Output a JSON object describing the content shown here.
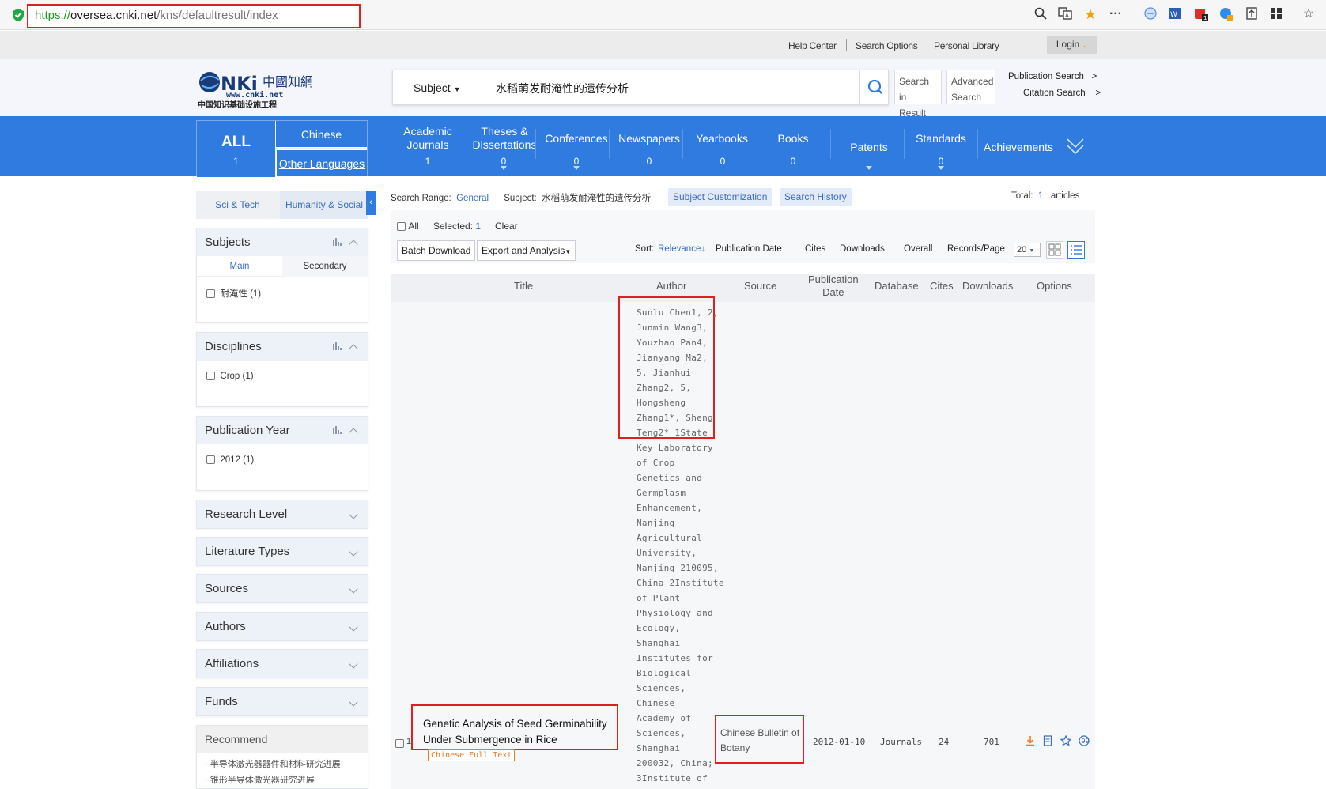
{
  "browser": {
    "url_scheme": "https://",
    "url_host": "oversea.cnki.net",
    "url_path": "/kns/defaultresult/index",
    "icons": [
      "shield-icon",
      "zoom-icon",
      "translate-icon",
      "star-icon",
      "more-icon",
      "extension-icon",
      "word-icon",
      "badge-icon",
      "collection-icon",
      "upload-icon",
      "grid-icon",
      "bookmark-icon"
    ]
  },
  "top_links": {
    "help": "Help Center",
    "options": "Search Options",
    "library": "Personal Library",
    "login": "Login"
  },
  "logo": {
    "main": "CNKi中国知网",
    "url": "www.cnki.net",
    "sub": "中国知识基础设施工程"
  },
  "search": {
    "field": "Subject",
    "query": "水稻萌发耐淹性的遗传分析",
    "search_in_result_1": "Search in",
    "search_in_result_2": "Result",
    "advanced_1": "Advanced",
    "advanced_2": "Search",
    "publication_search": "Publication Search",
    "citation_search": "Citation Search",
    "arrow": ">"
  },
  "nav": {
    "all_label": "ALL",
    "all_count": "1",
    "chinese": "Chinese",
    "other_languages": "Other Languages",
    "items": [
      {
        "l1": "Academic",
        "l2": "Journals",
        "count": "1"
      },
      {
        "l1": "Theses &",
        "l2": "Dissertations",
        "count": "0"
      },
      {
        "l1": "Conferences",
        "l2": "",
        "count": "0"
      },
      {
        "l1": "Newspapers",
        "l2": "",
        "count": "0"
      },
      {
        "l1": "Yearbooks",
        "l2": "",
        "count": "0"
      },
      {
        "l1": "Books",
        "l2": "",
        "count": "0"
      },
      {
        "l1": "Patents",
        "l2": "",
        "count": ""
      },
      {
        "l1": "Standards",
        "l2": "",
        "count": "0"
      },
      {
        "l1": "Achievements",
        "l2": "",
        "count": ""
      }
    ]
  },
  "sidebar": {
    "tab_sci": "Sci & Tech",
    "tab_hum": "Humanity & Social",
    "subjects": "Subjects",
    "main": "Main",
    "secondary": "Secondary",
    "subject_facet": "耐淹性  (1)",
    "disciplines": "Disciplines",
    "discipline_facet": "Crop  (1)",
    "pubyear": "Publication Year",
    "year_facet": "2012  (1)",
    "collapsed": [
      "Research Level",
      "Literature Types",
      "Sources",
      "Authors",
      "Affiliations",
      "Funds"
    ],
    "recommend": "Recommend",
    "rec_items": [
      "半导体激光器器件和材料研究进展",
      "锥形半导体激光器研究进展"
    ]
  },
  "results": {
    "range_label": "Search Range:",
    "range_value": "General",
    "subject_label": "Subject:",
    "subject_value": "水稻萌发耐淹性的遗传分析",
    "subject_custom": "Subject Customization",
    "history": "Search History",
    "total_label": "Total:",
    "total_value": "1",
    "total_unit": "articles",
    "all": "All",
    "selected_label": "Selected:",
    "selected_value": "1",
    "clear": "Clear",
    "batch_download": "Batch Download",
    "export": "Export and Analysis",
    "sort_label": "Sort:",
    "sort_relevance": "Relevance",
    "sort_pubdate": "Publication Date",
    "sort_cites": "Cites",
    "sort_downloads": "Downloads",
    "sort_overall": "Overall",
    "records_label": "Records/Page",
    "records_value": "20",
    "columns": {
      "title": "Title",
      "author": "Author",
      "source": "Source",
      "pubdate_1": "Publication",
      "pubdate_2": "Date",
      "database": "Database",
      "cites": "Cites",
      "downloads": "Downloads",
      "options": "Options"
    },
    "row": {
      "index": "1",
      "title_1": "Genetic Analysis of Seed Germinability",
      "title_2": "Under Submergence in Rice",
      "fulltext_tag": "Chinese Full Text",
      "author_lines": [
        "Sunlu Chen1, 2,",
        "Junmin Wang3,",
        "Youzhao Pan4,",
        "Jianyang Ma2,",
        "5, Jianhui",
        "Zhang2, 5,",
        "Hongsheng",
        "Zhang1*, Sheng",
        "Teng2* 1State",
        "Key Laboratory",
        "of Crop",
        "Genetics and",
        "Germplasm",
        "Enhancement,",
        "Nanjing",
        "Agricultural",
        "University,",
        "Nanjing 210095,",
        "China 2Institute",
        "of Plant",
        "Physiology and",
        "Ecology,",
        "Shanghai",
        "Institutes for",
        "Biological",
        "Sciences,",
        "Chinese",
        "Academy of",
        "Sciences,",
        "Shanghai",
        "200032, China;",
        "3Institute of"
      ],
      "source_1": "Chinese Bulletin of",
      "source_2": "Botany",
      "date": "2012-01-10",
      "database": "Journals",
      "cites": "24",
      "downloads": "701"
    }
  },
  "colors": {
    "nav_blue": "#2f7be0",
    "link_blue": "#3a6dc4",
    "highlight_red": "#e02020",
    "tag_orange": "#f07a20"
  }
}
